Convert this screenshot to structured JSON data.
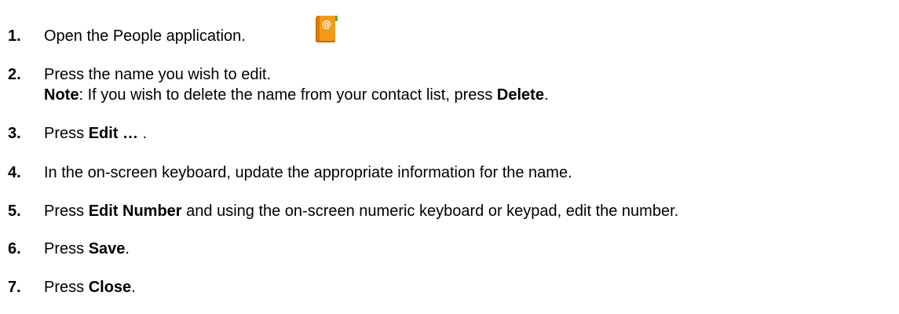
{
  "steps": [
    {
      "number": "1.",
      "parts": [
        "Open the People application."
      ],
      "icon": "people-app-icon",
      "icon_colors": {
        "book": "#f39a1b",
        "book_edge": "#c56a00",
        "tab": "#3bb54a",
        "at_sign": "#ffffff"
      }
    },
    {
      "number": "2.",
      "parts": [
        "Press the name you wish to edit."
      ],
      "note": {
        "label": "Note",
        "text_before": ": If you wish to delete the name from your contact list, press ",
        "bold": "Delete",
        "text_after": "."
      }
    },
    {
      "number": "3.",
      "parts": [
        "Press ",
        "Edit …",
        " ."
      ]
    },
    {
      "number": "4.",
      "parts": [
        "In the on-screen keyboard, update the appropriate information for the name."
      ]
    },
    {
      "number": "5.",
      "parts": [
        "Press ",
        "Edit Number",
        " and using the on-screen numeric keyboard or keypad, edit the number."
      ]
    },
    {
      "number": "6.",
      "parts": [
        "Press ",
        "Save",
        "."
      ]
    },
    {
      "number": "7.",
      "parts": [
        "Press ",
        "Close",
        "."
      ]
    }
  ]
}
